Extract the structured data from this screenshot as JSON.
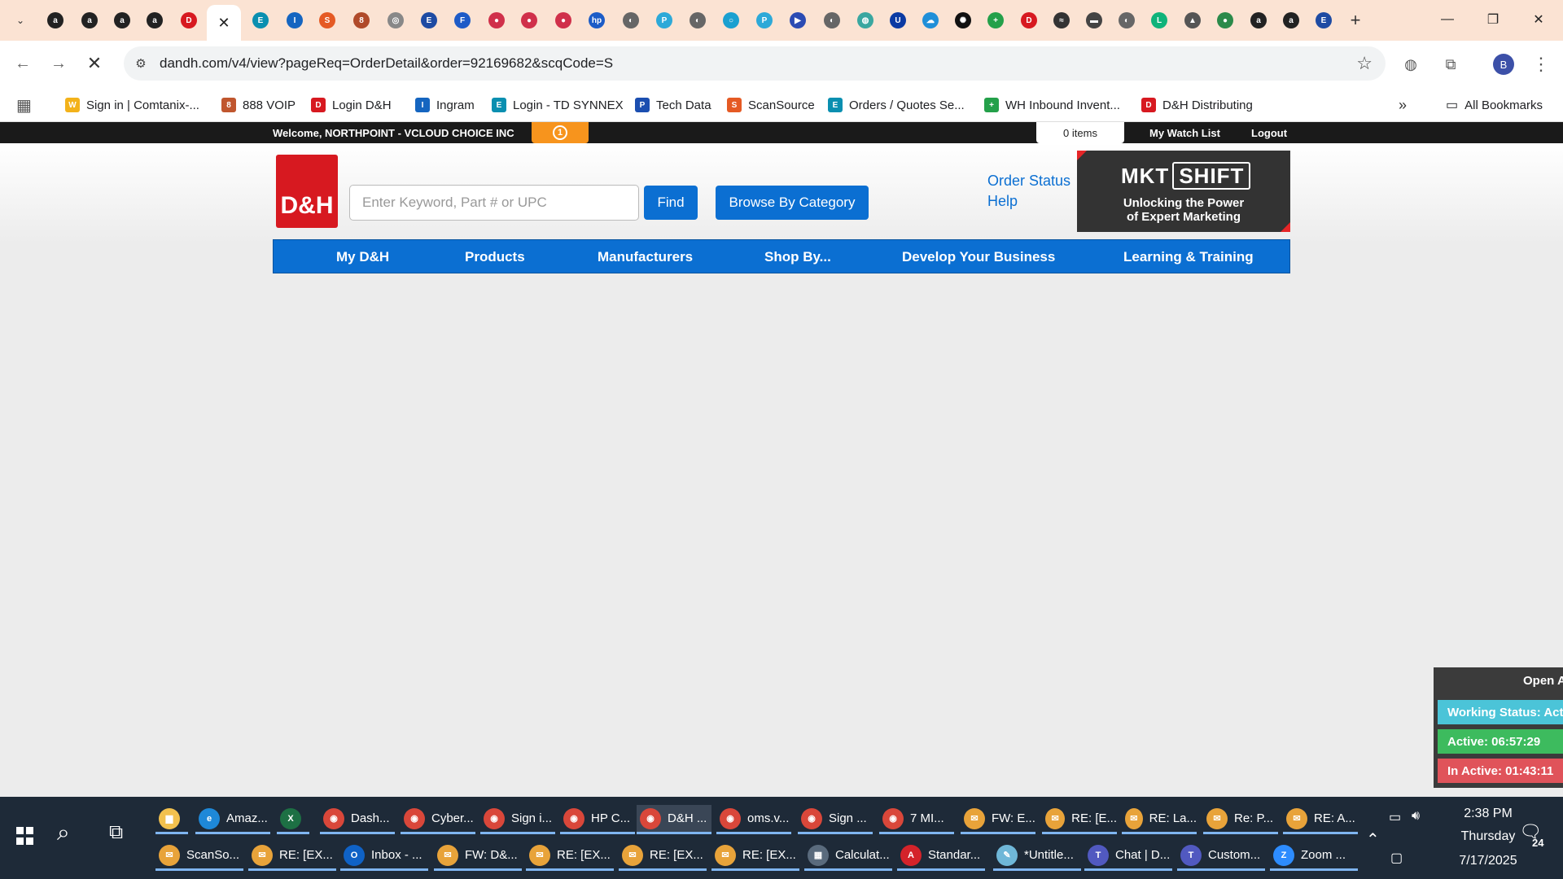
{
  "browser": {
    "tabs": [
      {
        "icon": "amazon-icon",
        "glyph": "a",
        "color": "#222"
      },
      {
        "icon": "amazon-icon",
        "glyph": "a",
        "color": "#222"
      },
      {
        "icon": "amazon-icon",
        "glyph": "a",
        "color": "#222"
      },
      {
        "icon": "amazon-icon",
        "glyph": "a",
        "color": "#222"
      },
      {
        "icon": "dandh-icon",
        "glyph": "D",
        "color": "#d71920"
      },
      {
        "icon": "close-icon",
        "glyph": "✕",
        "active": true
      },
      {
        "icon": "ec-icon",
        "glyph": "E",
        "color": "#0a8fb0"
      },
      {
        "icon": "ingram-icon",
        "glyph": "I",
        "color": "#1565c0"
      },
      {
        "icon": "scansource-icon",
        "glyph": "S",
        "color": "#e55a24"
      },
      {
        "icon": "voip-icon",
        "glyph": "8",
        "color": "#b04a2a"
      },
      {
        "icon": "spinner-icon",
        "glyph": "◎",
        "color": "#888"
      },
      {
        "icon": "etn-icon",
        "glyph": "E",
        "color": "#1e4ba3"
      },
      {
        "icon": "f-icon",
        "glyph": "F",
        "color": "#1e5bc7"
      },
      {
        "icon": "red-circle-icon",
        "glyph": "●",
        "color": "#d0304a"
      },
      {
        "icon": "red-circle-icon",
        "glyph": "●",
        "color": "#d0304a"
      },
      {
        "icon": "red-circle-icon",
        "glyph": "●",
        "color": "#d0304a"
      },
      {
        "icon": "hp-icon",
        "glyph": "hp",
        "color": "#1c5cc7"
      },
      {
        "icon": "globe-icon",
        "glyph": "◐",
        "color": "#666"
      },
      {
        "icon": "p-icon",
        "glyph": "P",
        "color": "#2da9d8"
      },
      {
        "icon": "globe-icon",
        "glyph": "◐",
        "color": "#666"
      },
      {
        "icon": "circle-icon",
        "glyph": "○",
        "color": "#1aa0d0"
      },
      {
        "icon": "p-icon",
        "glyph": "P",
        "color": "#2da9d8"
      },
      {
        "icon": "play-icon",
        "glyph": "▶",
        "color": "#2b4bb3"
      },
      {
        "icon": "globe-icon",
        "glyph": "◐",
        "color": "#666"
      },
      {
        "icon": "shield-icon",
        "glyph": "◍",
        "color": "#3aa7a0"
      },
      {
        "icon": "u-icon",
        "glyph": "U",
        "color": "#0b3aa3"
      },
      {
        "icon": "cloud-icon",
        "glyph": "☁",
        "color": "#1f8fd8"
      },
      {
        "icon": "chatgpt-icon",
        "glyph": "✺",
        "color": "#111"
      },
      {
        "icon": "plus-icon",
        "glyph": "+",
        "color": "#24a04a"
      },
      {
        "icon": "dandh-icon",
        "glyph": "D",
        "color": "#d71920"
      },
      {
        "icon": "chart-icon",
        "glyph": "≈",
        "color": "#333"
      },
      {
        "icon": "truck-icon",
        "glyph": "▬",
        "color": "#444"
      },
      {
        "icon": "globe-icon",
        "glyph": "◐",
        "color": "#666"
      },
      {
        "icon": "logi-icon",
        "glyph": "L",
        "color": "#0fb37a"
      },
      {
        "icon": "car-icon",
        "glyph": "▲",
        "color": "#555"
      },
      {
        "icon": "leaf-icon",
        "glyph": "●",
        "color": "#2b8a4a"
      },
      {
        "icon": "amazon-icon",
        "glyph": "a",
        "color": "#222"
      },
      {
        "icon": "amazon-icon",
        "glyph": "a",
        "color": "#222"
      },
      {
        "icon": "etn-icon",
        "glyph": "E",
        "color": "#1e4ba3"
      }
    ],
    "url": "dandh.com/v4/view?pageReq=OrderDetail&order=92169682&scqCode=S",
    "profile_initial": "B",
    "bookmarks": [
      {
        "label": "Sign in | Comtanix-...",
        "icon": "w-icon",
        "glyph": "W",
        "color": "#f3b21a"
      },
      {
        "label": "888 VOIP",
        "icon": "voip-icon",
        "glyph": "8",
        "color": "#c0562e"
      },
      {
        "label": "Login D&H",
        "icon": "dandh-icon",
        "glyph": "D",
        "color": "#d71920"
      },
      {
        "label": "Ingram",
        "icon": "ingram-icon",
        "glyph": "I",
        "color": "#1565c0"
      },
      {
        "label": "Login - TD SYNNEX",
        "icon": "ec-icon",
        "glyph": "E",
        "color": "#0a8fb0"
      },
      {
        "label": "Tech Data",
        "icon": "techdata-icon",
        "glyph": "P",
        "color": "#1b4eb0"
      },
      {
        "label": "ScanSource",
        "icon": "scansource-icon",
        "glyph": "S",
        "color": "#e55a24"
      },
      {
        "label": "Orders / Quotes Se...",
        "icon": "ec-icon",
        "glyph": "E",
        "color": "#0a8fb0"
      },
      {
        "label": "WH Inbound Invent...",
        "icon": "sheets-icon",
        "glyph": "+",
        "color": "#24a04a"
      },
      {
        "label": "D&H Distributing",
        "icon": "dandh-icon",
        "glyph": "D",
        "color": "#d71920"
      }
    ],
    "all_bookmarks_label": "All Bookmarks"
  },
  "page": {
    "welcome": "Welcome, NORTHPOINT - VCLOUD CHOICE INC",
    "notification_count": "1",
    "cart": "0 items",
    "watch_list": "My Watch List",
    "logout": "Logout",
    "logo_text": "D&H",
    "search_placeholder": "Enter Keyword, Part # or UPC",
    "find_label": "Find",
    "browse_label": "Browse By Category",
    "order_status": "Order Status",
    "help": "Help",
    "banner": {
      "brand_a": "MKT",
      "brand_b": "SHIFT",
      "line1": "Unlocking the Power",
      "line2": "of Expert Marketing"
    },
    "nav": [
      "My D&H",
      "Products",
      "Manufacturers",
      "Shop By...",
      "Develop Your Business",
      "Learning & Training"
    ],
    "colors": {
      "brand_red": "#d71920",
      "nav_blue": "#0b6fd2",
      "notif_orange": "#f7941d"
    }
  },
  "status_widget": {
    "open_label": "Open A",
    "working_status": "Working Status: Acti",
    "active": "Active: 06:57:29",
    "inactive": "In Active: 01:43:11",
    "colors": {
      "working": "#4bc4d8",
      "active": "#3dbb5e",
      "inactive": "#e0535a"
    }
  },
  "taskbar": {
    "row1": [
      {
        "label": "",
        "icon": "file-explorer-icon",
        "glyph": "▆",
        "color": "#f2c14e"
      },
      {
        "label": "Amaz...",
        "icon": "edge-icon",
        "glyph": "e",
        "color": "#1e88d8"
      },
      {
        "label": "",
        "icon": "excel-icon",
        "glyph": "X",
        "color": "#1d7044"
      },
      {
        "label": "Dash...",
        "icon": "chrome-icon",
        "glyph": "◉",
        "color": "#d9473a"
      },
      {
        "label": "Cyber...",
        "icon": "chrome-icon",
        "glyph": "◉",
        "color": "#d9473a"
      },
      {
        "label": "Sign i...",
        "icon": "chrome-icon",
        "glyph": "◉",
        "color": "#d9473a"
      },
      {
        "label": "HP C...",
        "icon": "chrome-icon",
        "glyph": "◉",
        "color": "#d9473a"
      },
      {
        "label": "D&H ...",
        "icon": "chrome-icon",
        "glyph": "◉",
        "color": "#d9473a",
        "selected": true
      },
      {
        "label": "oms.v...",
        "icon": "chrome-icon",
        "glyph": "◉",
        "color": "#d9473a"
      },
      {
        "label": "Sign ...",
        "icon": "chrome-icon",
        "glyph": "◉",
        "color": "#d9473a"
      },
      {
        "label": "7 MI...",
        "icon": "chrome-icon",
        "glyph": "◉",
        "color": "#d9473a"
      },
      {
        "label": "FW: E...",
        "icon": "mail-icon",
        "glyph": "✉",
        "color": "#e8a33a"
      },
      {
        "label": "RE: [E...",
        "icon": "mail-icon",
        "glyph": "✉",
        "color": "#e8a33a"
      },
      {
        "label": "RE: La...",
        "icon": "mail-icon",
        "glyph": "✉",
        "color": "#e8a33a"
      },
      {
        "label": "Re: P...",
        "icon": "mail-icon",
        "glyph": "✉",
        "color": "#e8a33a"
      },
      {
        "label": "RE: A...",
        "icon": "mail-icon",
        "glyph": "✉",
        "color": "#e8a33a"
      }
    ],
    "row2": [
      {
        "label": "ScanSo...",
        "icon": "mail-icon",
        "glyph": "✉",
        "color": "#e8a33a"
      },
      {
        "label": "RE: [EX...",
        "icon": "mail-icon",
        "glyph": "✉",
        "color": "#e8a33a"
      },
      {
        "label": "Inbox - ...",
        "icon": "outlook-icon",
        "glyph": "O",
        "color": "#0f62c6"
      },
      {
        "label": "FW: D&...",
        "icon": "mail-icon",
        "glyph": "✉",
        "color": "#e8a33a"
      },
      {
        "label": "RE: [EX...",
        "icon": "mail-icon",
        "glyph": "✉",
        "color": "#e8a33a"
      },
      {
        "label": "RE: [EX...",
        "icon": "mail-icon",
        "glyph": "✉",
        "color": "#e8a33a"
      },
      {
        "label": "RE: [EX...",
        "icon": "mail-icon",
        "glyph": "✉",
        "color": "#e8a33a"
      },
      {
        "label": "Calculat...",
        "icon": "calculator-icon",
        "glyph": "▦",
        "color": "#5a6b7d"
      },
      {
        "label": "Standar...",
        "icon": "pdf-icon",
        "glyph": "A",
        "color": "#d4232a"
      },
      {
        "label": "*Untitle...",
        "icon": "notepad-icon",
        "glyph": "✎",
        "color": "#6fb7d8"
      },
      {
        "label": "Chat | D...",
        "icon": "teams-icon",
        "glyph": "T",
        "color": "#5159c0"
      },
      {
        "label": "Custom...",
        "icon": "teams-icon",
        "glyph": "T",
        "color": "#5159c0"
      },
      {
        "label": "Zoom ...",
        "icon": "zoom-icon",
        "glyph": "Z",
        "color": "#2d8cff"
      }
    ],
    "time": "2:38 PM",
    "day": "Thursday",
    "date": "7/17/2025",
    "notifications": "24"
  }
}
